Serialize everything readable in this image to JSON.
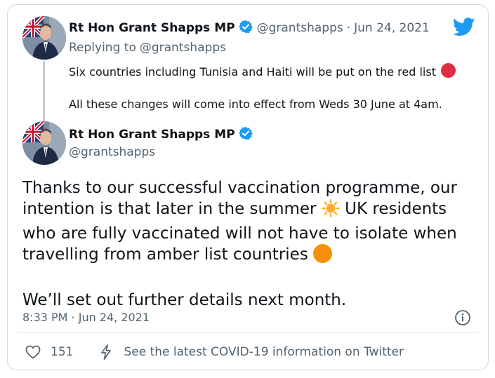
{
  "reply_tweet": {
    "author_name": "Rt Hon Grant Shapps MP",
    "handle": "@grantshapps",
    "separator": "·",
    "date": "Jun 24, 2021",
    "replying_to_prefix": "Replying to",
    "replying_to_handle": "@grantshapps",
    "line1": "Six countries including Tunisia and Haiti will be put on the red list",
    "line2": "All these changes will come into effect from Weds 30 June at 4am."
  },
  "main_tweet": {
    "author_name": "Rt Hon Grant Shapps MP",
    "handle": "@grantshapps",
    "body_part1": "Thanks to our successful vaccination programme, our intention is that later in the summer",
    "body_part2": " UK residents who are fully vaccinated will not have to isolate when travelling from amber list countries",
    "body_para2": "We’ll set out further details next month.",
    "timestamp": "8:33 PM · Jun 24, 2021",
    "like_count": "151",
    "covid_info_link": "See the latest COVID-19 information on Twitter"
  },
  "icons": {
    "brand": "twitter-bird-icon",
    "verified": "verified-badge-icon",
    "red_circle": "red-circle-emoji",
    "sun": "sun-emoji",
    "orange_circle": "orange-circle-emoji",
    "info": "info-icon",
    "like": "heart-icon",
    "covid": "lightning-icon"
  },
  "colors": {
    "twitter_blue": "#1d9bf0",
    "secondary_text": "#536471",
    "red_emoji": "#dd2e44",
    "orange_emoji": "#f4900c",
    "sun_emoji": "#ffac33"
  }
}
